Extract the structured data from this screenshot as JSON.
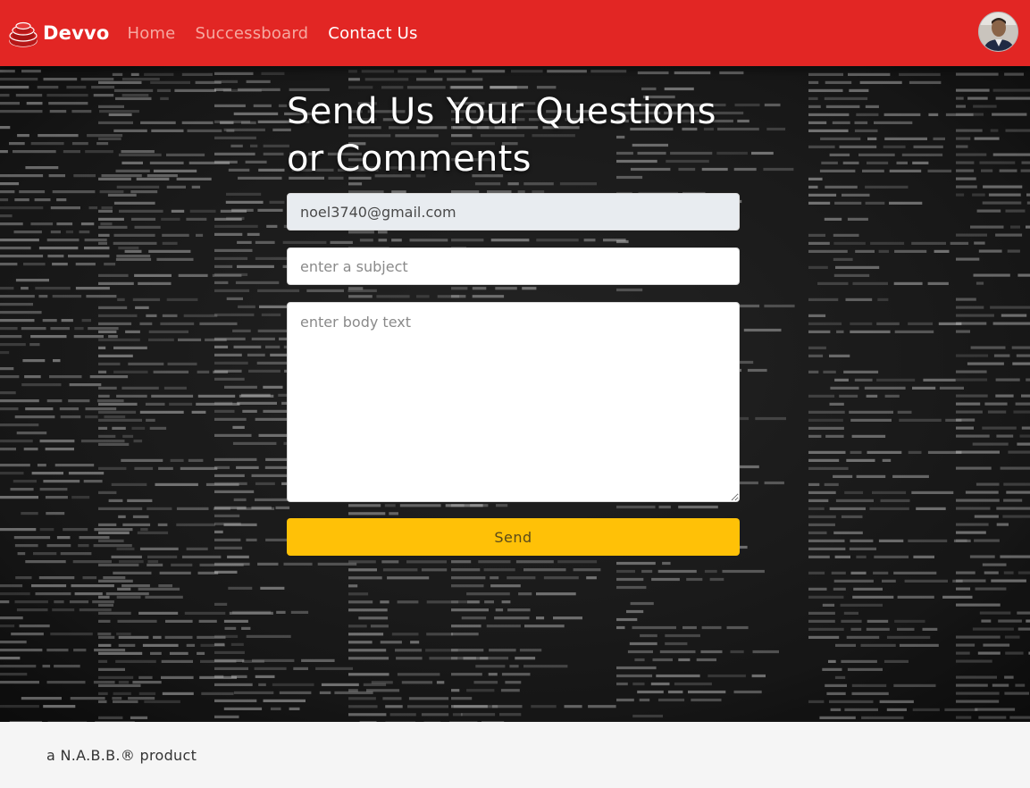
{
  "navbar": {
    "brand": "Devvo",
    "links": [
      {
        "label": "Home",
        "active": false
      },
      {
        "label": "Successboard",
        "active": false
      },
      {
        "label": "Contact Us",
        "active": true
      }
    ],
    "logo_icon": "stacked-red-cylinder-icon",
    "avatar_icon": "user-avatar-photo"
  },
  "main": {
    "title_line1": "Send Us Your Questions",
    "title_line2": "or Comments",
    "form": {
      "email_value": "noel3740@gmail.com",
      "subject_placeholder": "enter a subject",
      "body_placeholder": "enter body text",
      "send_label": "Send"
    }
  },
  "footer": {
    "text": "a N.A.B.B.® product"
  },
  "colors": {
    "navbar": "#e22624",
    "send_button": "#ffc107",
    "background_theme": "dark code wallpaper"
  }
}
